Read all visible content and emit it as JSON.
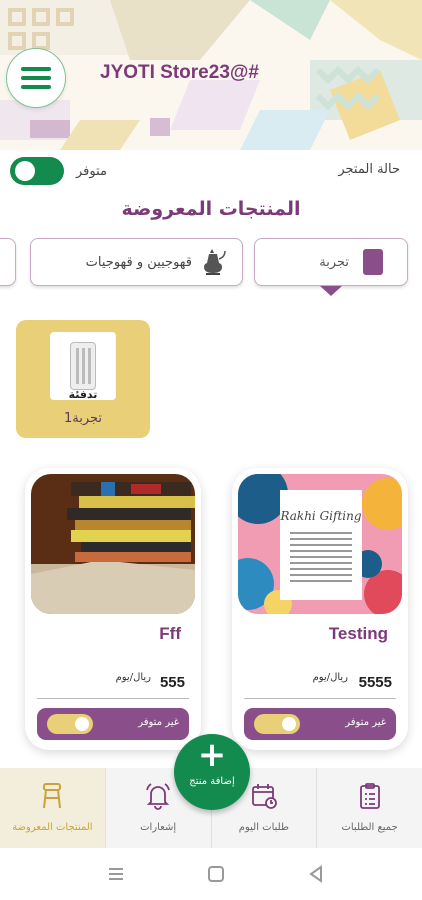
{
  "header": {
    "store_name": "JYOTI Store23@#",
    "menu_icon": "hamburger-icon"
  },
  "store_status": {
    "label": "حالة المتجر",
    "availability_label": "متوفر",
    "enabled": true
  },
  "section_title": "المنتجات المعروضة",
  "categories": [
    {
      "label": "تجربة",
      "selected": true
    },
    {
      "label": "قهوجيين و قهوجيات",
      "icon": "coffee-pot-icon",
      "selected": false
    }
  ],
  "subcategory": {
    "label": "تدفئة",
    "name": "تجربة1",
    "icon": "heater-icon"
  },
  "products": [
    {
      "name": "Testing",
      "price": "5555",
      "unit": "ريال/يوم",
      "status": "غير متوفر",
      "image_text": "Rakhi Gifting"
    },
    {
      "name": "Fff",
      "price": "555",
      "unit": "ريال/يوم",
      "status": "غير متوفر"
    }
  ],
  "fab": {
    "label": "إضافة منتج"
  },
  "bottom_nav": [
    {
      "label": "جميع الطلبات",
      "icon": "clipboard-icon"
    },
    {
      "label": "طلبات اليوم",
      "icon": "calendar-icon"
    },
    {
      "label": "إشعارات",
      "icon": "bell-icon"
    },
    {
      "label": "المنتجات المعروضة",
      "icon": "stool-icon",
      "active": true
    }
  ],
  "colors": {
    "primary": "#138a4e",
    "accent": "#7d3a78",
    "gold": "#e8cf78",
    "purple_bar": "#8a4f8a"
  }
}
